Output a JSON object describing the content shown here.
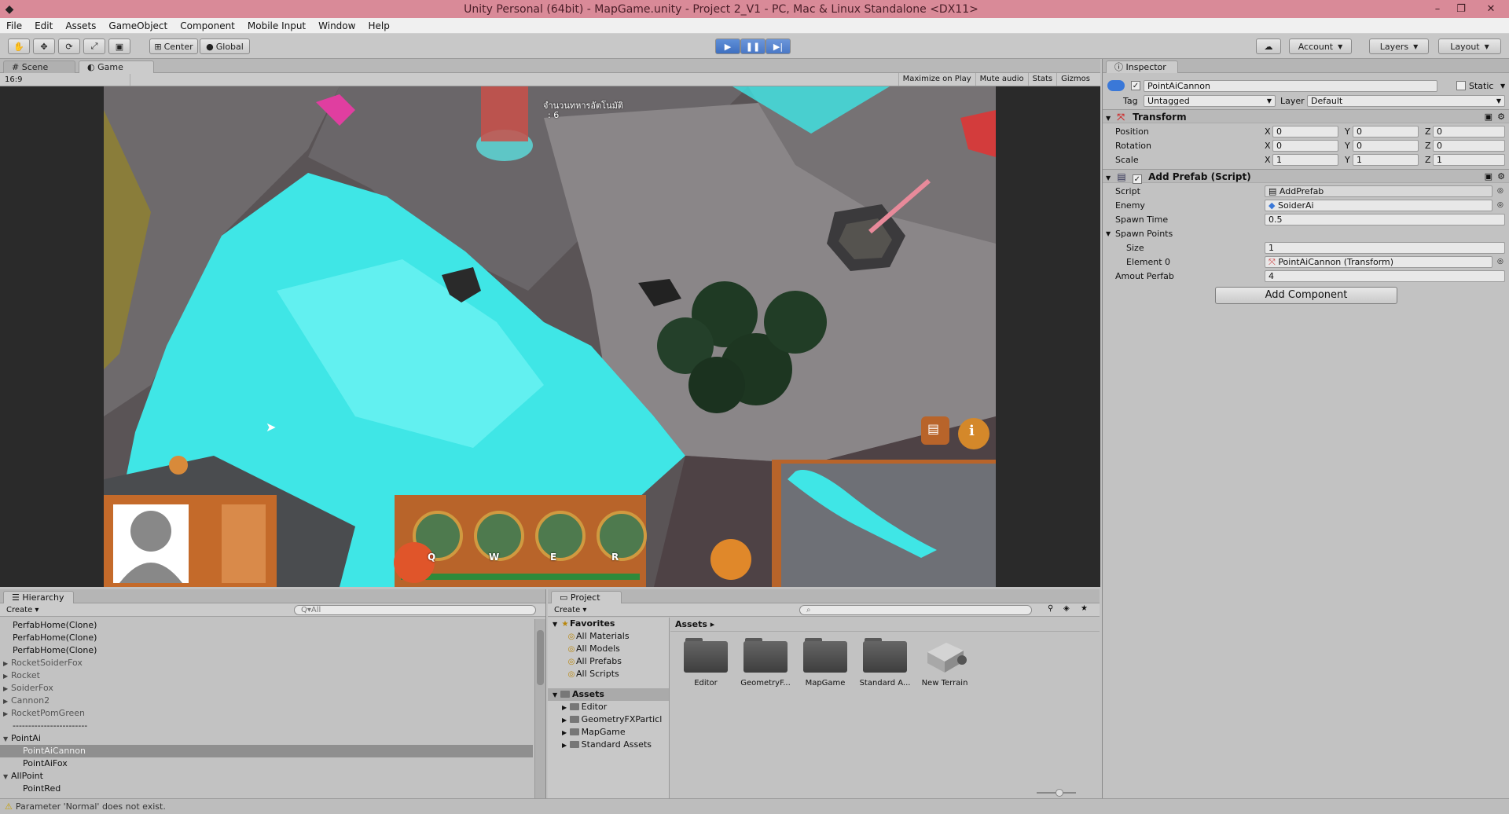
{
  "window": {
    "title": "Unity Personal (64bit) - MapGame.unity - Project 2_V1 - PC, Mac & Linux Standalone <DX11>",
    "controls": [
      "–",
      "❐",
      "✕"
    ]
  },
  "menu": [
    "File",
    "Edit",
    "Assets",
    "GameObject",
    "Component",
    "Mobile Input",
    "Window",
    "Help"
  ],
  "toolbar": {
    "pivot": "Center",
    "space": "Global",
    "account": "Account",
    "layers": "Layers",
    "layout": "Layout"
  },
  "scene_tabs": {
    "scene": "Scene",
    "game": "Game"
  },
  "game_bar": {
    "aspect": "16:9",
    "options": [
      "Maximize on Play",
      "Mute audio",
      "Stats",
      "Gizmos"
    ]
  },
  "game_hud": {
    "top_text": "จำนวนทหารอัตโนมัติ",
    "top_count": ": 6",
    "skill_keys": [
      "Q",
      "W",
      "E",
      "R"
    ]
  },
  "hierarchy": {
    "tab": "Hierarchy",
    "create": "Create",
    "search_placeholder": "Q▾All",
    "rows": [
      {
        "label": "PerfabHome(Clone)",
        "style": "normal"
      },
      {
        "label": "PerfabHome(Clone)",
        "style": "normal"
      },
      {
        "label": "PerfabHome(Clone)",
        "style": "normal"
      },
      {
        "label": "RocketSoiderFox",
        "style": "grey",
        "arrow": "▶"
      },
      {
        "label": "Rocket",
        "style": "grey",
        "arrow": "▶"
      },
      {
        "label": "SoiderFox",
        "style": "grey",
        "arrow": "▶"
      },
      {
        "label": "Cannon2",
        "style": "grey",
        "arrow": "▶"
      },
      {
        "label": "RocketPomGreen",
        "style": "grey",
        "arrow": "▶"
      },
      {
        "label": "------------------------",
        "style": "normal"
      },
      {
        "label": "PointAi",
        "style": "normal",
        "arrow": "▼"
      },
      {
        "label": "PointAiCannon",
        "style": "sel",
        "child": true
      },
      {
        "label": "PointAiFox",
        "style": "normal",
        "child": true
      },
      {
        "label": "AllPoint",
        "style": "normal",
        "arrow": "▼"
      },
      {
        "label": "PointRed",
        "style": "normal",
        "child": true
      }
    ]
  },
  "project": {
    "tab": "Project",
    "create": "Create",
    "favorites": {
      "title": "Favorites",
      "items": [
        "All Materials",
        "All Models",
        "All Prefabs",
        "All Scripts"
      ]
    },
    "assets_tree": {
      "title": "Assets",
      "items": [
        "Editor",
        "GeometryFXParticl",
        "MapGame",
        "Standard Assets"
      ]
    },
    "breadcrumb": "Assets",
    "grid": [
      "Editor",
      "GeometryF...",
      "MapGame",
      "Standard A...",
      "New Terrain"
    ]
  },
  "inspector": {
    "tab": "Inspector",
    "object_name": "PointAiCannon",
    "static_label": "Static",
    "tag_label": "Tag",
    "tag_value": "Untagged",
    "layer_label": "Layer",
    "layer_value": "Default",
    "transform": {
      "title": "Transform",
      "position_label": "Position",
      "rotation_label": "Rotation",
      "scale_label": "Scale",
      "position": [
        "0",
        "0",
        "0"
      ],
      "rotation": [
        "0",
        "0",
        "0"
      ],
      "scale": [
        "1",
        "1",
        "1"
      ]
    },
    "add_prefab": {
      "title": "Add Prefab (Script)",
      "script_label": "Script",
      "script_value": "AddPrefab",
      "enemy_label": "Enemy",
      "enemy_value": "SoiderAi",
      "spawn_time_label": "Spawn Time",
      "spawn_time_value": "0.5",
      "spawn_points_label": "Spawn Points",
      "size_label": "Size",
      "size_value": "1",
      "element0_label": "Element 0",
      "element0_value": "PointAiCannon (Transform)",
      "amount_label": "Amout Perfab",
      "amount_value": "4"
    },
    "add_component": "Add Component"
  },
  "status": {
    "message": "Parameter 'Normal' does not exist."
  },
  "colors": {
    "titlebar": "#d98a98",
    "play_active": "#4a7acb",
    "water": "#3fe6e6",
    "rock": "#8a8688"
  }
}
